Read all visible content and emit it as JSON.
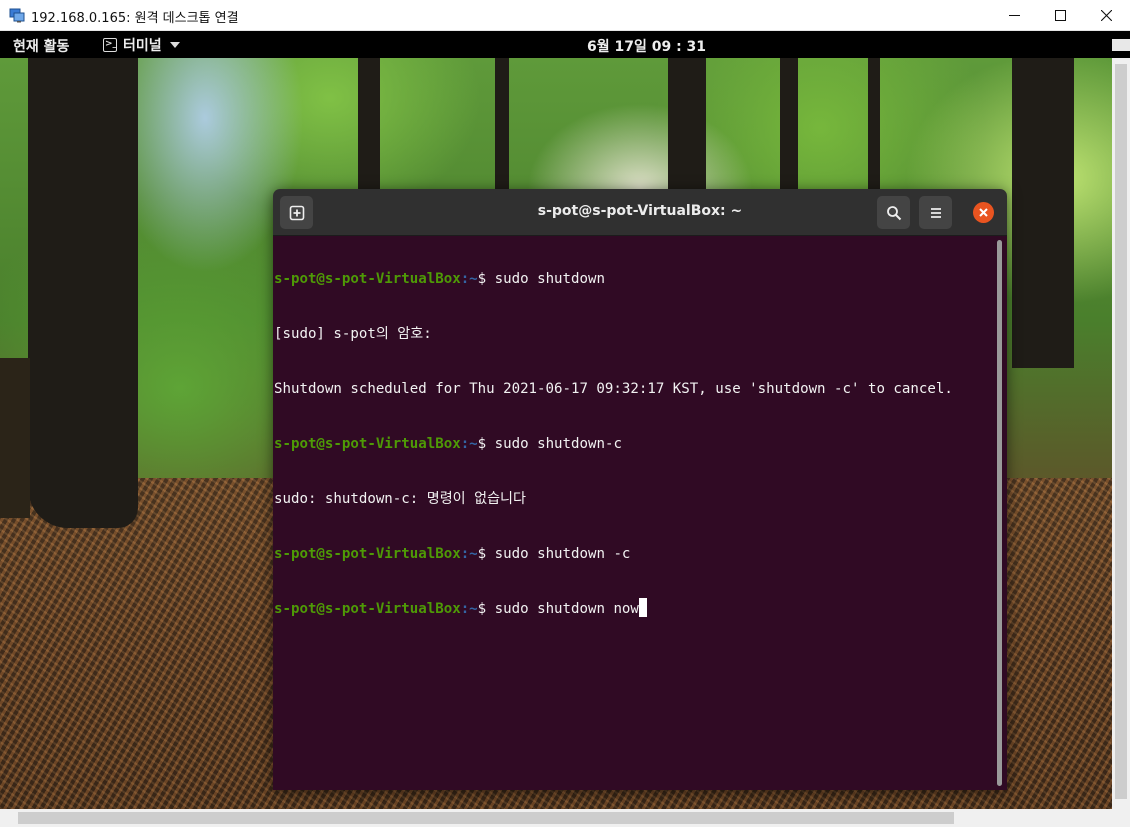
{
  "rdp": {
    "title": "192.168.0.165: 원격 데스크톱 연결",
    "icon": "remote-desktop-icon",
    "controls": [
      "minimize-icon",
      "maximize-icon",
      "close-icon"
    ]
  },
  "gnome": {
    "activities": "현재 활동",
    "app_menu": "터미널",
    "clock": "6월 17일  09 : 31"
  },
  "terminal": {
    "title": "s-pot@s-pot-VirtualBox: ~",
    "accent": "#e95420",
    "background": "#300a24",
    "prompt_user": "s-pot@s-pot-VirtualBox",
    "prompt_path": ":~",
    "prompt_symbol": "$ ",
    "lines": {
      "l1_cmd": "sudo shutdown",
      "l2": "[sudo] s-pot의 암호:",
      "l3": "Shutdown scheduled for Thu 2021-06-17 09:32:17 KST, use 'shutdown -c' to cancel.",
      "l4_cmd": "sudo shutdown-c",
      "l5": "sudo: shutdown-c: 명령이 없습니다",
      "l6_cmd": "sudo shutdown -c",
      "l7_cmd": "sudo shutdown now"
    }
  }
}
